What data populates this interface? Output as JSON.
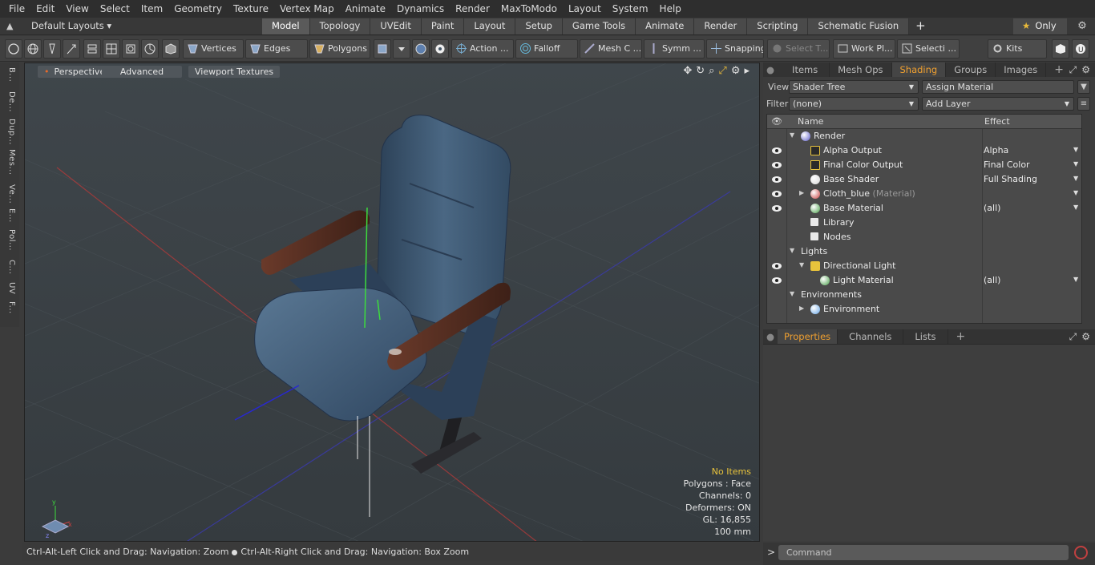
{
  "menu": [
    "File",
    "Edit",
    "View",
    "Select",
    "Item",
    "Geometry",
    "Texture",
    "Vertex Map",
    "Animate",
    "Dynamics",
    "Render",
    "MaxToModo",
    "Layout",
    "System",
    "Help"
  ],
  "layout": {
    "name": "Default Layouts",
    "tabs": [
      "Model",
      "Topology",
      "UVEdit",
      "Paint",
      "Layout",
      "Setup",
      "Game Tools",
      "Animate",
      "Render",
      "Scripting",
      "Schematic Fusion"
    ],
    "active_tab": "Model",
    "only_label": "Only"
  },
  "toolbar": {
    "vertices": "Vertices",
    "edges": "Edges",
    "polygons": "Polygons",
    "action": "Action ...",
    "falloff": "Falloff",
    "mesh": "Mesh C ...",
    "symm": "Symm ...",
    "snapping": "Snapping",
    "select_t": "Select T...",
    "workplane": "Work Pl...",
    "selecti": "Selecti ...",
    "kits": "Kits"
  },
  "left_tabs": [
    "B...",
    "De...",
    "Dup...",
    "Mes...",
    "Ve...",
    "E...",
    "Pol...",
    "C...",
    "UV",
    "F..."
  ],
  "viewport": {
    "perspective": "Perspective",
    "advanced": "Advanced",
    "textures": "Viewport Textures",
    "info": {
      "items": "No Items",
      "polygons": "Polygons : Face",
      "channels": "Channels: 0",
      "deformers": "Deformers: ON",
      "gl": "GL: 16,855",
      "scale": "100 mm"
    }
  },
  "status": {
    "left": "Ctrl-Alt-Left Click and Drag: Navigation: Zoom",
    "right": "Ctrl-Alt-Right Click and Drag: Navigation: Box Zoom"
  },
  "panel": {
    "tabs": [
      "Items",
      "Mesh Ops",
      "Shading",
      "Groups",
      "Images"
    ],
    "active_tab": "Shading",
    "view_label": "View",
    "view_value": "Shader Tree",
    "assign": "Assign Material",
    "filter_label": "Filter",
    "filter_value": "(none)",
    "add_layer": "Add Layer",
    "col_name": "Name",
    "col_effect": "Effect",
    "rows": [
      {
        "name": "Render",
        "effect": ""
      },
      {
        "name": "Alpha Output",
        "effect": "Alpha"
      },
      {
        "name": "Final Color Output",
        "effect": "Final Color"
      },
      {
        "name": "Base Shader",
        "effect": "Full Shading"
      },
      {
        "name": "Cloth_blue",
        "sub": "(Material)",
        "effect": ""
      },
      {
        "name": "Base Material",
        "effect": "(all)"
      },
      {
        "name": "Library",
        "effect": ""
      },
      {
        "name": "Nodes",
        "effect": ""
      },
      {
        "name": "Lights",
        "effect": ""
      },
      {
        "name": "Directional Light",
        "effect": ""
      },
      {
        "name": "Light Material",
        "effect": "(all)"
      },
      {
        "name": "Environments",
        "effect": ""
      },
      {
        "name": "Environment",
        "effect": ""
      }
    ],
    "prop_tabs": [
      "Properties",
      "Channels",
      "Lists"
    ],
    "prop_active": "Properties",
    "command_placeholder": "Command"
  }
}
